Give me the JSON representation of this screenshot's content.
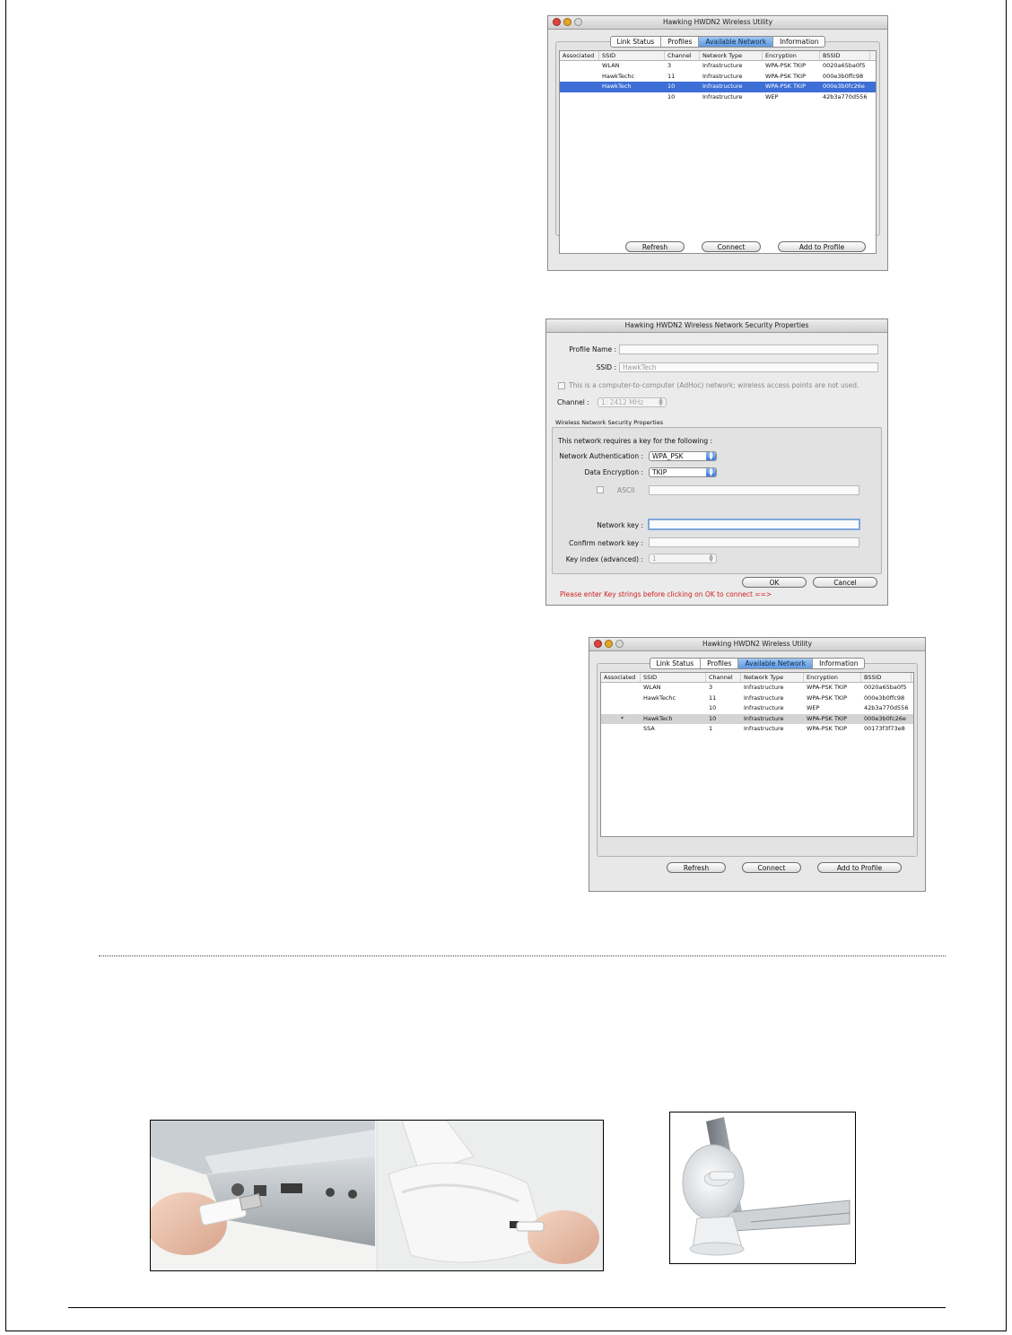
{
  "utility_window_1": {
    "title": "Hawking HWDN2 Wireless Utility",
    "tabs": [
      "Link Status",
      "Profiles",
      "Available Network",
      "Information"
    ],
    "active_tab": "Available Network",
    "columns": [
      "Associated",
      "SSID",
      "Channel",
      "Network Type",
      "Encryption",
      "BSSID"
    ],
    "rows": [
      [
        "",
        "WLAN",
        "3",
        "Infrastructure",
        "WPA-PSK TKIP",
        "0020a65ba0f5"
      ],
      [
        "",
        "HawkTechc",
        "11",
        "Infrastructure",
        "WPA-PSK TKIP",
        "000e3b0ffc98"
      ],
      [
        "",
        "HawkTech",
        "10",
        "Infrastructure",
        "WPA-PSK TKIP",
        "000e3b0fc26e"
      ],
      [
        "",
        "",
        "10",
        "Infrastructure",
        "WEP",
        "42b3a770d556"
      ]
    ],
    "selected_row": 2,
    "buttons": [
      "Refresh",
      "Connect",
      "Add to Profile"
    ]
  },
  "security_dialog": {
    "title": "Hawking HWDN2 Wireless Network Security Properties",
    "profile_name_label": "Profile Name :",
    "ssid_label": "SSID :",
    "ssid_value": "HawkTech",
    "adhoc_label": "This is a computer-to-computer (AdHoc) network; wireless access points are not used.",
    "channel_label": "Channel :",
    "channel_value": "1: 2412 MHz",
    "group_title": "Wireless Network Security Properties",
    "key_required_text": "This network requires a key for the following :",
    "auth_label": "Network Authentication :",
    "auth_value": "WPA_PSK",
    "encryption_label": "Data Encryption :",
    "encryption_value": "TKIP",
    "ascii_label": "ASCII",
    "network_key_label": "Network key :",
    "confirm_key_label": "Confirm network key :",
    "key_index_label": "Key index (advanced) :",
    "key_index_value": "1",
    "ok_label": "OK",
    "cancel_label": "Cancel",
    "warning": "Please enter Key strings before clicking on OK to connect ==>",
    "warning_color": "#d02020"
  },
  "utility_window_2": {
    "title": "Hawking HWDN2 Wireless Utility",
    "tabs": [
      "Link Status",
      "Profiles",
      "Available Network",
      "Information"
    ],
    "active_tab": "Available Network",
    "columns": [
      "Associated",
      "SSID",
      "Channel",
      "Network Type",
      "Encryption",
      "BSSID"
    ],
    "rows": [
      [
        "",
        "WLAN",
        "3",
        "Infrastructure",
        "WPA-PSK TKIP",
        "0020a65ba0f5"
      ],
      [
        "",
        "HawkTechc",
        "11",
        "Infrastructure",
        "WPA-PSK TKIP",
        "000e3b0ffc98"
      ],
      [
        "",
        "",
        "10",
        "Infrastructure",
        "WEP",
        "42b3a770d556"
      ],
      [
        "*",
        "HawkTech",
        "10",
        "Infrastructure",
        "WPA-PSK TKIP",
        "000e3b0fc26e"
      ],
      [
        "",
        "SSA",
        "1",
        "Infrastructure",
        "WPA-PSK TKIP",
        "00173f3f73e8"
      ]
    ],
    "highlighted_row": 3,
    "buttons": [
      "Refresh",
      "Connect",
      "Add to Profile"
    ]
  },
  "accent_color": "#3d6fd6",
  "photos": {
    "left": "usb-cable-connection-photo",
    "right": "dish-antenna-laptop-photo"
  }
}
